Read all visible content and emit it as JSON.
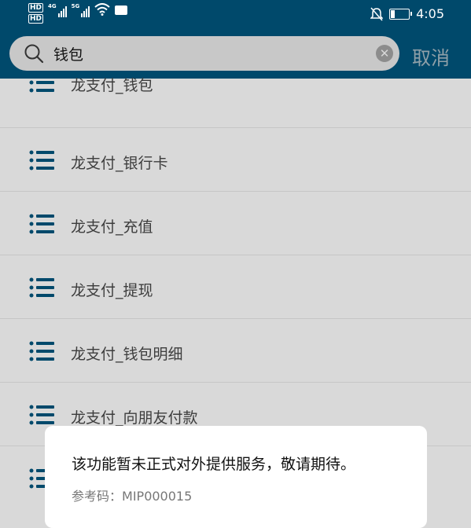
{
  "status_bar": {
    "hd1": "HD",
    "hd2": "HD",
    "net1": "4G",
    "net2": "5G",
    "time": "4:05"
  },
  "search": {
    "value": "钱包",
    "cancel_label": "取消"
  },
  "list": {
    "items": [
      {
        "label": "龙支付_钱包"
      },
      {
        "label": "龙支付_银行卡"
      },
      {
        "label": "龙支付_充值"
      },
      {
        "label": "龙支付_提现"
      },
      {
        "label": "龙支付_钱包明细"
      },
      {
        "label": "龙支付_向朋友付款"
      },
      {
        "label": ""
      }
    ]
  },
  "dialog": {
    "message": "该功能暂未正式对外提供服务，敬请期待。",
    "reference_label": "参考码：",
    "reference_code": "MIP000015"
  },
  "colors": {
    "header": "#00496b",
    "overlay_bg": "#d9d9d9",
    "list_icon": "#00496b"
  },
  "icons": [
    "search-icon",
    "clear-icon",
    "list-icon",
    "wifi-icon",
    "signal-icon",
    "mute-icon",
    "battery-icon"
  ]
}
